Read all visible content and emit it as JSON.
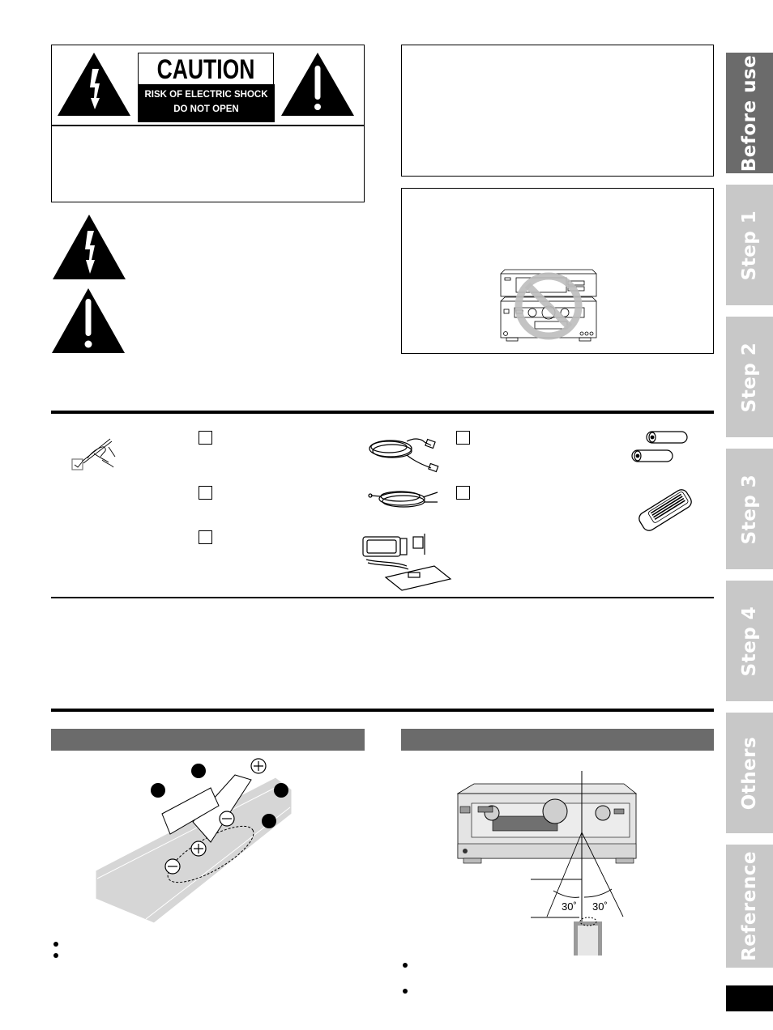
{
  "caution_label": {
    "title": "CAUTION",
    "line1": "RISK OF ELECTRIC SHOCK",
    "line2": "DO NOT OPEN"
  },
  "side_tabs": [
    {
      "label": "Before use",
      "active": true,
      "color": "#6b6b6b"
    },
    {
      "label": "Step 1",
      "active": false,
      "color": "#c8c8c8"
    },
    {
      "label": "Step 2",
      "active": false,
      "color": "#c8c8c8"
    },
    {
      "label": "Step 3",
      "active": false,
      "color": "#c8c8c8"
    },
    {
      "label": "Step 4",
      "active": false,
      "color": "#c8c8c8"
    },
    {
      "label": "Others",
      "active": false,
      "color": "#c8c8c8"
    },
    {
      "label": "Reference",
      "active": false,
      "color": "#c8c8c8"
    }
  ],
  "accessories": {
    "items": [
      {
        "icon": "ac-power-cord-icon"
      },
      {
        "icon": "speaker-cable-icon"
      },
      {
        "icon": "am-fm-antenna-icon"
      },
      {
        "icon": "batteries-icon"
      },
      {
        "icon": "remote-control-icon"
      }
    ]
  },
  "remote_usage": {
    "angle_left": "30˚",
    "angle_right": "30˚"
  },
  "colors": {
    "section_header": "#6b6b6b",
    "tab_active": "#6b6b6b",
    "tab_inactive": "#c8c8c8",
    "prohibition": "#bdbdbd"
  }
}
